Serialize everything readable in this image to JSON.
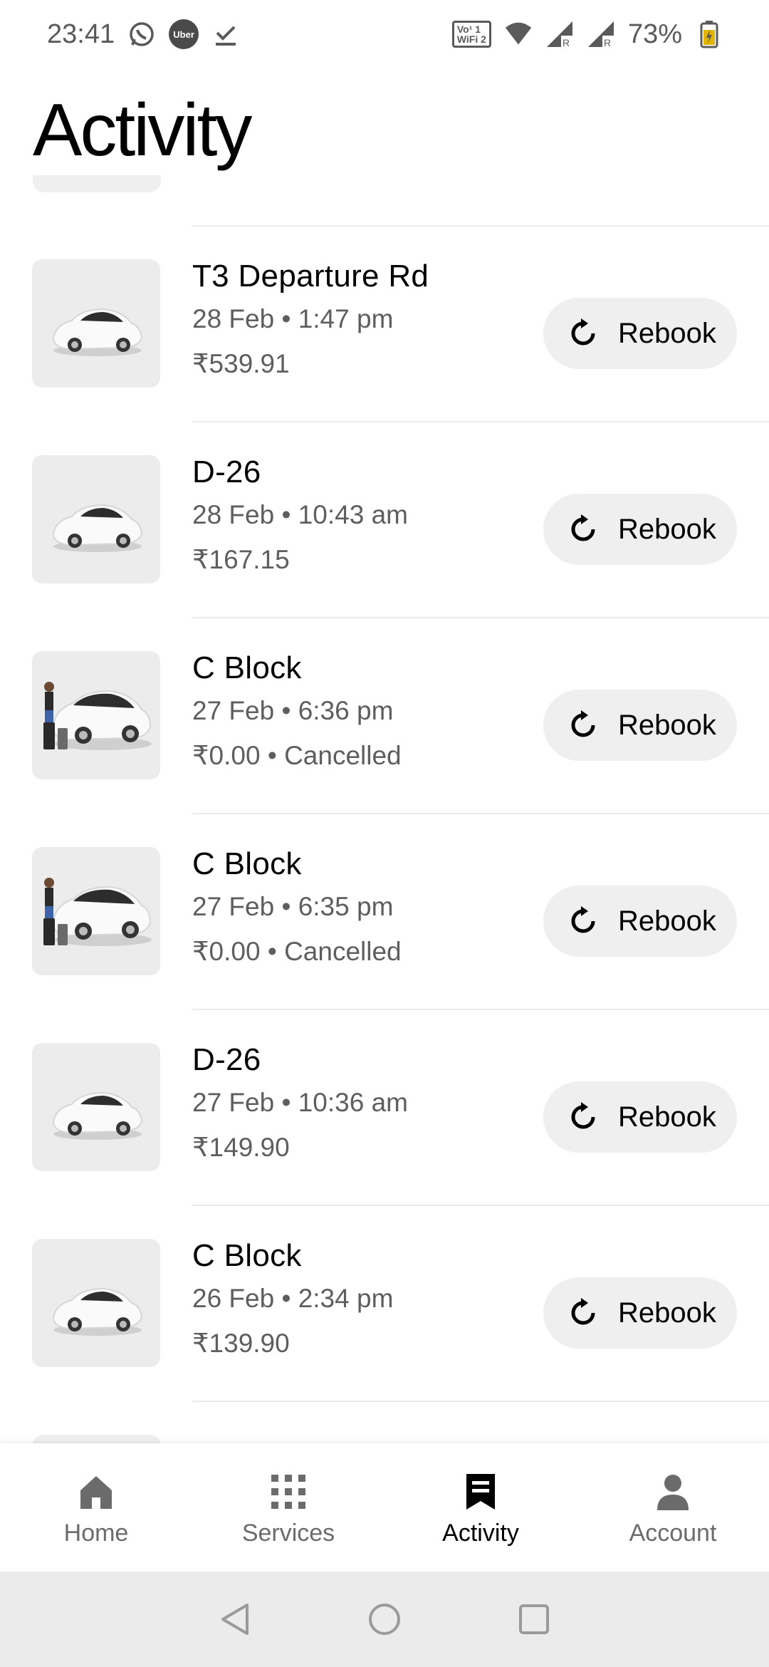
{
  "status_bar": {
    "time": "23:41",
    "battery": "73%",
    "notification_icons": [
      "whatsapp-icon",
      "uber-icon",
      "download-done-icon"
    ],
    "uber_badge_text": "Uber",
    "wifi_badge_top": "Vo¹ 1",
    "wifi_badge_bottom": "WiFi 2",
    "system_icons": [
      "volte-wifi-icon",
      "wifi-icon",
      "signal-r-icon",
      "signal-r-icon",
      "battery-charging-icon"
    ]
  },
  "page": {
    "title": "Activity"
  },
  "trips": [
    {
      "title": "T3 Departure Rd",
      "date": "28 Feb • 1:47 pm",
      "fare": "₹539.91",
      "image": "car-icon",
      "rebook_label": "Rebook"
    },
    {
      "title": "D-26",
      "date": "28 Feb • 10:43 am",
      "fare": "₹167.15",
      "image": "car-icon",
      "rebook_label": "Rebook"
    },
    {
      "title": "C Block",
      "date": "27 Feb • 6:36 pm",
      "fare": "₹0.00 • Cancelled",
      "image": "car-with-passenger-icon",
      "rebook_label": "Rebook"
    },
    {
      "title": "C Block",
      "date": "27 Feb • 6:35 pm",
      "fare": "₹0.00 • Cancelled",
      "image": "car-with-passenger-icon",
      "rebook_label": "Rebook"
    },
    {
      "title": "D-26",
      "date": "27 Feb • 10:36 am",
      "fare": "₹149.90",
      "image": "car-icon",
      "rebook_label": "Rebook"
    },
    {
      "title": "C Block",
      "date": "26 Feb • 2:34 pm",
      "fare": "₹139.90",
      "image": "car-icon",
      "rebook_label": "Rebook"
    }
  ],
  "bottom_nav": [
    {
      "label": "Home",
      "icon": "home-icon",
      "active": false
    },
    {
      "label": "Services",
      "icon": "grid-icon",
      "active": false
    },
    {
      "label": "Activity",
      "icon": "receipt-icon",
      "active": true
    },
    {
      "label": "Account",
      "icon": "person-icon",
      "active": false
    }
  ],
  "system_nav": [
    "back-icon",
    "home-circle-icon",
    "recents-icon"
  ]
}
